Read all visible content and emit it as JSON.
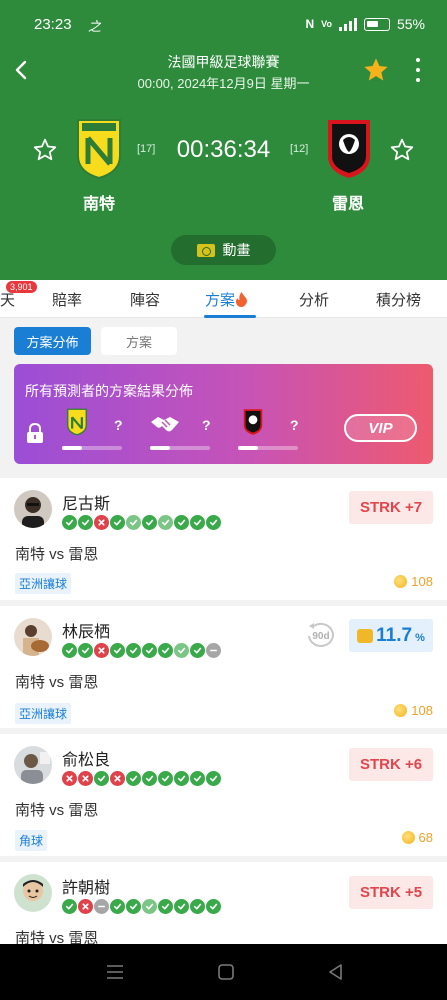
{
  "status_bar": {
    "time": "23:23",
    "app_icon_text": "之",
    "battery": "55%"
  },
  "header": {
    "league": "法國甲級足球聯賽",
    "datetime": "00:00, 2024年12月9日 星期一",
    "timer": "00:36:34",
    "home": {
      "name": "南特",
      "rank": "[17]"
    },
    "away": {
      "name": "雷恩",
      "rank": "[12]"
    },
    "animation_label": "動畫",
    "accent": "#2e8b3c"
  },
  "tabs": {
    "badge": "3,901",
    "items": [
      {
        "label": "天"
      },
      {
        "label": "賠率"
      },
      {
        "label": "陣容"
      },
      {
        "label": "方案"
      },
      {
        "label": "分析"
      },
      {
        "label": "積分榜"
      }
    ],
    "active_index": 3,
    "active_color": "#1a7fd4"
  },
  "subtabs": {
    "distribution": "方案分佈",
    "plans": "方案"
  },
  "vip": {
    "title": "所有預測者的方案結果分佈",
    "home_q": "?",
    "draw_q": "?",
    "away_q": "?",
    "button": "VIP"
  },
  "predictors": [
    {
      "name": "尼古斯",
      "record": [
        "w",
        "w",
        "l",
        "w",
        "h",
        "w",
        "h",
        "w",
        "w",
        "w"
      ],
      "matchup": "南特 vs 雷恩",
      "tag": "亞洲讓球",
      "coins": "108",
      "strk": "STRK +7"
    },
    {
      "name": "林辰栖",
      "record": [
        "w",
        "w",
        "l",
        "w",
        "w",
        "w",
        "w",
        "h",
        "w",
        "d"
      ],
      "matchup": "南特 vs 雷恩",
      "tag": "亞洲讓球",
      "coins": "108",
      "rate": "11.7",
      "rate_unit": "%",
      "badge_90d": "90d"
    },
    {
      "name": "俞松良",
      "record": [
        "l",
        "l",
        "w",
        "l",
        "w",
        "w",
        "w",
        "w",
        "w",
        "w"
      ],
      "matchup": "南特 vs 雷恩",
      "tag": "角球",
      "coins": "68",
      "strk": "STRK +6"
    },
    {
      "name": "許朝樹",
      "record": [
        "w",
        "l",
        "d",
        "w",
        "w",
        "h",
        "w",
        "w",
        "w",
        "w"
      ],
      "matchup": "南特 vs 雷恩",
      "strk": "STRK +5"
    }
  ]
}
